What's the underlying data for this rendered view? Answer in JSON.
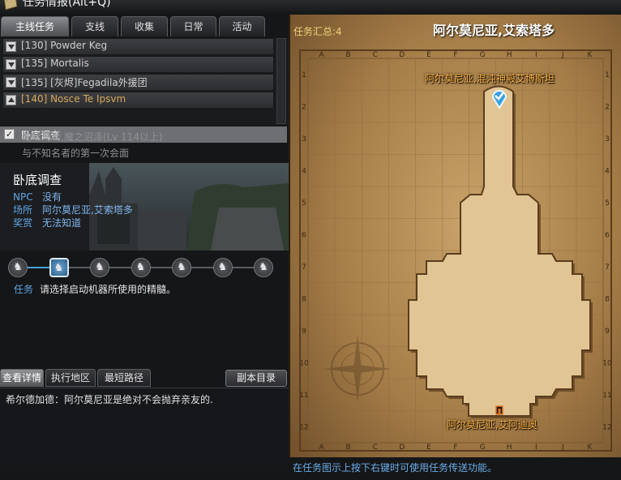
{
  "window": {
    "title": "任务情报(Alt+Q)"
  },
  "tabs": [
    {
      "label": "主线任务"
    },
    {
      "label": "支线"
    },
    {
      "label": "收集"
    },
    {
      "label": "日常"
    },
    {
      "label": "活动"
    }
  ],
  "quest_list": [
    {
      "label": "[130] Powder Keg"
    },
    {
      "label": "[135] Mortalis"
    },
    {
      "label": "[135] [灰烬]Fegadila外援团"
    },
    {
      "label": "[140] Nosce Te Ipsvm"
    }
  ],
  "selected_quest": {
    "label": "卧底调查",
    "sub_lines": [
      "帕哈玛勒,魔之沼泽(Lv 114以上)",
      "与不知名者的第一次会面"
    ]
  },
  "detail": {
    "title": "卧底调查",
    "rows": [
      {
        "key": "NPC",
        "value": "没有"
      },
      {
        "key": "场所",
        "value": "阿尔莫尼亚,艾索塔多"
      },
      {
        "key": "奖赏",
        "value": "无法知道"
      }
    ]
  },
  "progress": {
    "total_steps": 7,
    "current_step": 2,
    "node_glyph": "♞"
  },
  "task": {
    "key": "任务",
    "value": "请选择启动机器所使用的精髓。"
  },
  "bottom_tabs": [
    {
      "label": "查看详情"
    },
    {
      "label": "执行地区"
    },
    {
      "label": "最短路径"
    }
  ],
  "dungeon_button": "副本目录",
  "npc_dialogue": "希尔德加德：阿尔莫尼亚是绝对不会抛弃亲友的.",
  "map": {
    "summary": "任务汇总:4",
    "title": "阿尔莫尼亚,艾索塔多",
    "columns": [
      "A",
      "B",
      "C",
      "D",
      "E",
      "F",
      "G",
      "H",
      "I",
      "J",
      "K"
    ],
    "rows": [
      "1",
      "2",
      "3",
      "4",
      "5",
      "6",
      "7",
      "8",
      "9",
      "10",
      "11",
      "12"
    ],
    "label_top": "阿尔莫尼亚,混沌神殿艾博斯坦",
    "label_bottom": "阿尔莫尼亚,艾阿迪奥",
    "hint": "在任务图示上按下右键时可使用任务传送功能。"
  },
  "colors": {
    "accent_blue": "#5fa7e6",
    "map_label": "#ffb347",
    "parchment": "#c9a36a"
  }
}
